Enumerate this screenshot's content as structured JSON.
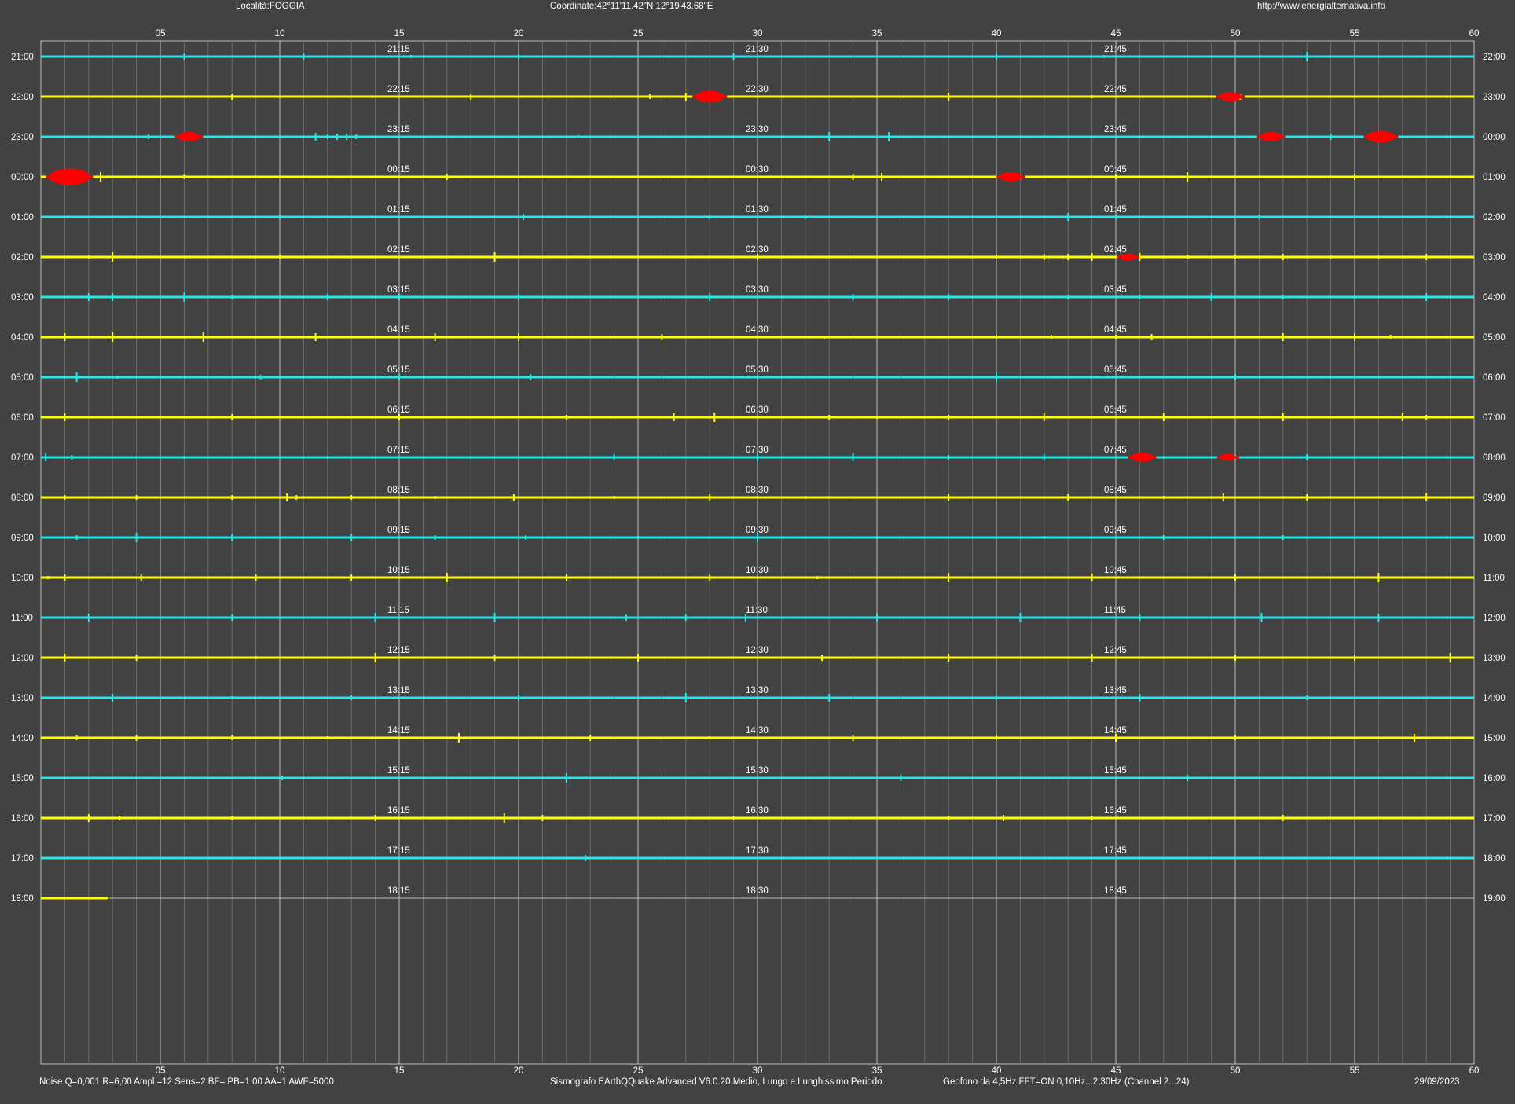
{
  "header": {
    "location": "Località:FOGGIA",
    "coordinates": "Coordinate:42°11'11.42\"N  12°19'43.68\"E",
    "url": "http://www.energialternativa.info"
  },
  "footer": {
    "settings": "Noise Q=0,001 R=6,00 Ampl.=12 Sens=2 BF= PB=1,00 AA=1 AWF=5000",
    "software": "Sismografo  EArthQQuake Advanced V6.0.20  Medio, Lungo e Lunghissimo Periodo",
    "sensor": "Geofono da 4,5Hz FFT=ON 0,10Hz...2,30Hz",
    "channel": "(Channel 2...24)",
    "date": "29/09/2023"
  },
  "colors": {
    "background": "#424242",
    "grid_major": "#bdbdbd",
    "grid_minor": "#6a6a6a",
    "trace_a": "#26e6e6",
    "trace_b": "#ffff00",
    "event": "#ff0000",
    "text": "#ffffff"
  },
  "chart_data": {
    "type": "line",
    "x_axis": {
      "unit": "minutes",
      "min": 0,
      "max": 60,
      "major_ticks": [
        5,
        10,
        15,
        20,
        25,
        30,
        35,
        40,
        45,
        50,
        55,
        60
      ],
      "major_tick_labels": [
        "05",
        "10",
        "15",
        "20",
        "25",
        "30",
        "35",
        "40",
        "45",
        "50",
        "55",
        "60"
      ]
    },
    "rows": [
      {
        "left_label": "21:00",
        "right_label": "22:00",
        "marks": [
          "21:15",
          "21:30",
          "21:45"
        ],
        "color": "cyan",
        "complete": true,
        "events": [],
        "spikes": [
          6,
          11,
          15.5,
          20,
          29,
          40,
          44.5,
          53
        ]
      },
      {
        "left_label": "22:00",
        "right_label": "23:00",
        "marks": [
          "22:15",
          "22:30",
          "22:45"
        ],
        "color": "yellow",
        "complete": true,
        "events": [
          {
            "minute": 28.0,
            "size": 3
          },
          {
            "minute": 49.8,
            "size": 2
          }
        ],
        "spikes": [
          8,
          18,
          25.5,
          27,
          38,
          44,
          50.2
        ]
      },
      {
        "left_label": "23:00",
        "right_label": "00:00",
        "marks": [
          "23:15",
          "23:30",
          "23:45"
        ],
        "color": "cyan",
        "complete": true,
        "events": [
          {
            "minute": 6.2,
            "size": 2
          },
          {
            "minute": 51.5,
            "size": 2
          },
          {
            "minute": 56.1,
            "size": 3
          }
        ],
        "spikes": [
          4.5,
          11.5,
          12,
          12.4,
          12.8,
          13.2,
          22.5,
          33,
          35.5,
          42,
          54
        ]
      },
      {
        "left_label": "00:00",
        "right_label": "01:00",
        "marks": [
          "00:15",
          "00:30",
          "00:45"
        ],
        "color": "yellow",
        "complete": true,
        "events": [
          {
            "minute": 1.2,
            "size": 5
          },
          {
            "minute": 40.6,
            "size": 2
          }
        ],
        "spikes": [
          2.5,
          6,
          17,
          34,
          35.2,
          41,
          45,
          48,
          55
        ]
      },
      {
        "left_label": "01:00",
        "right_label": "02:00",
        "marks": [
          "01:15",
          "01:30",
          "01:45"
        ],
        "color": "cyan",
        "complete": true,
        "events": [],
        "spikes": [
          10,
          20.2,
          28,
          32,
          43,
          45,
          51
        ]
      },
      {
        "left_label": "02:00",
        "right_label": "03:00",
        "marks": [
          "02:15",
          "02:30",
          "02:45"
        ],
        "color": "yellow",
        "complete": true,
        "events": [
          {
            "minute": 45.5,
            "size": 1
          }
        ],
        "spikes": [
          2,
          3,
          10,
          19,
          30,
          40,
          42,
          43,
          44,
          46,
          48,
          50,
          52,
          54,
          56,
          58
        ]
      },
      {
        "left_label": "03:00",
        "right_label": "04:00",
        "marks": [
          "03:15",
          "03:30",
          "03:45"
        ],
        "color": "cyan",
        "complete": true,
        "events": [],
        "spikes": [
          2,
          3,
          6,
          8,
          12,
          15,
          20,
          28,
          34,
          38,
          43,
          46,
          49,
          52,
          55,
          58
        ]
      },
      {
        "left_label": "04:00",
        "right_label": "05:00",
        "marks": [
          "04:15",
          "04:30",
          "04:45"
        ],
        "color": "yellow",
        "complete": true,
        "events": [],
        "spikes": [
          1,
          3,
          6.8,
          11.5,
          16.5,
          20,
          26,
          32.8,
          40,
          42.3,
          45,
          46.5,
          52,
          55,
          56.5
        ]
      },
      {
        "left_label": "05:00",
        "right_label": "06:00",
        "marks": [
          "05:15",
          "05:30",
          "05:45"
        ],
        "color": "cyan",
        "complete": true,
        "events": [],
        "spikes": [
          1.5,
          3.2,
          9.2,
          15,
          20.5,
          30,
          40,
          50
        ]
      },
      {
        "left_label": "06:00",
        "right_label": "07:00",
        "marks": [
          "06:15",
          "06:30",
          "06:45"
        ],
        "color": "yellow",
        "complete": true,
        "events": [],
        "spikes": [
          1,
          8,
          15,
          22,
          26.5,
          28.2,
          33,
          35,
          38,
          42,
          47,
          52,
          57,
          58
        ]
      },
      {
        "left_label": "07:00",
        "right_label": "08:00",
        "marks": [
          "07:15",
          "07:30",
          "07:45"
        ],
        "color": "cyan",
        "complete": true,
        "events": [
          {
            "minute": 46.1,
            "size": 2
          },
          {
            "minute": 49.7,
            "size": 1
          }
        ],
        "spikes": [
          0.2,
          1.3,
          6,
          12,
          18,
          24,
          30,
          34,
          38,
          42,
          47,
          50,
          53,
          57
        ]
      },
      {
        "left_label": "08:00",
        "right_label": "09:00",
        "marks": [
          "08:15",
          "08:30",
          "08:45"
        ],
        "color": "yellow",
        "complete": true,
        "events": [],
        "spikes": [
          1,
          4,
          8,
          10.3,
          10.7,
          13,
          16.5,
          19.8,
          24,
          28,
          32,
          38,
          43,
          47,
          49.5,
          53,
          58
        ]
      },
      {
        "left_label": "09:00",
        "right_label": "10:00",
        "marks": [
          "09:15",
          "09:30",
          "09:45"
        ],
        "color": "cyan",
        "complete": true,
        "events": [],
        "spikes": [
          1.5,
          4,
          8,
          13,
          16.5,
          20.3,
          25,
          30,
          35,
          42,
          47,
          52
        ]
      },
      {
        "left_label": "10:00",
        "right_label": "11:00",
        "marks": [
          "10:15",
          "10:30",
          "10:45"
        ],
        "color": "yellow",
        "complete": true,
        "events": [],
        "spikes": [
          0.3,
          1,
          4.2,
          9,
          13,
          17,
          22,
          28,
          32.5,
          38,
          44,
          50,
          56
        ]
      },
      {
        "left_label": "11:00",
        "right_label": "12:00",
        "marks": [
          "11:15",
          "11:30",
          "11:45"
        ],
        "color": "cyan",
        "complete": true,
        "events": [],
        "spikes": [
          2,
          8,
          14,
          19,
          24.5,
          27,
          29.5,
          35,
          41,
          46,
          51.1,
          56
        ]
      },
      {
        "left_label": "12:00",
        "right_label": "13:00",
        "marks": [
          "12:15",
          "12:30",
          "12:45"
        ],
        "color": "yellow",
        "complete": true,
        "events": [],
        "spikes": [
          1,
          4,
          9,
          14,
          19,
          25,
          32.7,
          38,
          44,
          50,
          55,
          59
        ]
      },
      {
        "left_label": "13:00",
        "right_label": "14:00",
        "marks": [
          "13:15",
          "13:30",
          "13:45"
        ],
        "color": "cyan",
        "complete": true,
        "events": [],
        "spikes": [
          3,
          8,
          13,
          20,
          27,
          33,
          40,
          46,
          53
        ]
      },
      {
        "left_label": "14:00",
        "right_label": "15:00",
        "marks": [
          "14:15",
          "14:30",
          "14:45"
        ],
        "color": "yellow",
        "complete": true,
        "events": [],
        "spikes": [
          1.5,
          4,
          8,
          12,
          17.5,
          23,
          28,
          34,
          40,
          45,
          50,
          57.5
        ]
      },
      {
        "left_label": "15:00",
        "right_label": "16:00",
        "marks": [
          "15:15",
          "15:30",
          "15:45"
        ],
        "color": "cyan",
        "complete": true,
        "events": [],
        "spikes": [
          10.1,
          22,
          36,
          48
        ]
      },
      {
        "left_label": "16:00",
        "right_label": "17:00",
        "marks": [
          "16:15",
          "16:30",
          "16:45"
        ],
        "color": "yellow",
        "complete": true,
        "events": [],
        "spikes": [
          2,
          3.3,
          8,
          14,
          19.4,
          21,
          29,
          38,
          40.3,
          44,
          52
        ]
      },
      {
        "left_label": "17:00",
        "right_label": "18:00",
        "marks": [
          "17:15",
          "17:30",
          "17:45"
        ],
        "color": "cyan",
        "complete": true,
        "events": [],
        "spikes": [
          22.8
        ]
      },
      {
        "left_label": "18:00",
        "right_label": "19:00",
        "marks": [
          "18:15",
          "18:30",
          "18:45"
        ],
        "color": "yellow",
        "complete": false,
        "trace_end_minute": 2.8,
        "events": [],
        "spikes": []
      }
    ]
  }
}
